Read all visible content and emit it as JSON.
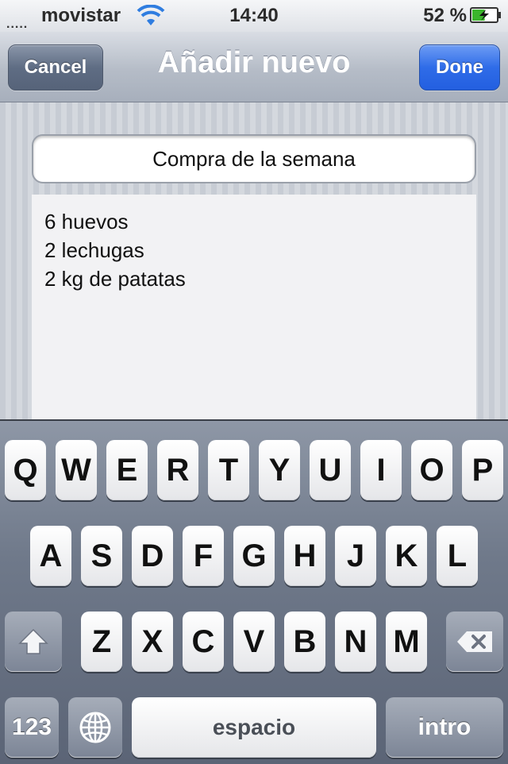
{
  "status_bar": {
    "carrier": "movistar",
    "time": "14:40",
    "battery_percent": "52 %",
    "battery_level": 0.52,
    "icons": [
      "signal-icon",
      "wifi-icon",
      "battery-charging-icon"
    ]
  },
  "nav": {
    "cancel_label": "Cancel",
    "title": "Añadir nuevo",
    "done_label": "Done"
  },
  "form": {
    "title_value": "Compra de la semana",
    "notes_lines": [
      "6 huevos",
      "2 lechugas",
      "2 kg de patatas"
    ]
  },
  "keyboard": {
    "row1": [
      "Q",
      "W",
      "E",
      "R",
      "T",
      "Y",
      "U",
      "I",
      "O",
      "P"
    ],
    "row2": [
      "A",
      "S",
      "D",
      "F",
      "G",
      "H",
      "J",
      "K",
      "L"
    ],
    "row3": [
      "Z",
      "X",
      "C",
      "V",
      "B",
      "N",
      "M"
    ],
    "numbers_label": "123",
    "space_label": "espacio",
    "return_label": "intro",
    "icons": [
      "shift-icon",
      "delete-icon",
      "globe-icon"
    ]
  },
  "colors": {
    "done_button": "#2f6ce8",
    "cancel_button": "#5f6d84",
    "battery_fill": "#3bb52c"
  }
}
